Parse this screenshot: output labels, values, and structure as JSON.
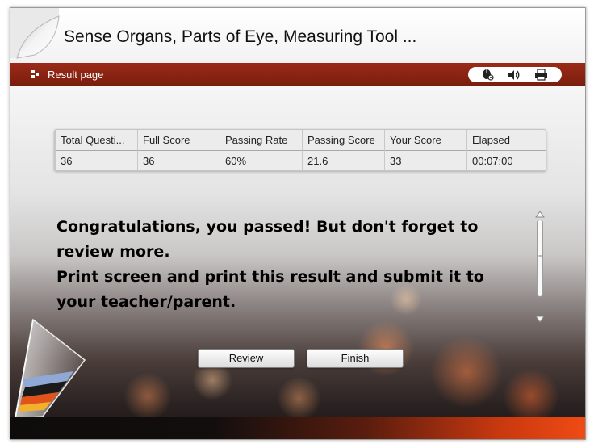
{
  "header": {
    "title": "Sense Organs, Parts of Eye, Measuring Tool ..."
  },
  "toolbar": {
    "page_label": "Result page",
    "tools": [
      {
        "icon": "mouse-settings-icon"
      },
      {
        "icon": "speaker-icon"
      },
      {
        "icon": "printer-icon"
      }
    ]
  },
  "results": {
    "columns": [
      {
        "header": "Total Questi...",
        "value": "36"
      },
      {
        "header": "Full Score",
        "value": "36"
      },
      {
        "header": "Passing Rate",
        "value": "60%"
      },
      {
        "header": "Passing Score",
        "value": "21.6"
      },
      {
        "header": "Your Score",
        "value": "33"
      },
      {
        "header": "Elapsed",
        "value": "00:07:00"
      }
    ]
  },
  "message": {
    "line1": "Congratulations, you passed! But don't forget to review more.",
    "line2": "Print screen and print this result and submit it to your teacher/parent."
  },
  "buttons": {
    "review_label": "Review",
    "finish_label": "Finish"
  },
  "colors": {
    "header_bar": "#8a2413",
    "accent_orange": "#ef4b14"
  }
}
